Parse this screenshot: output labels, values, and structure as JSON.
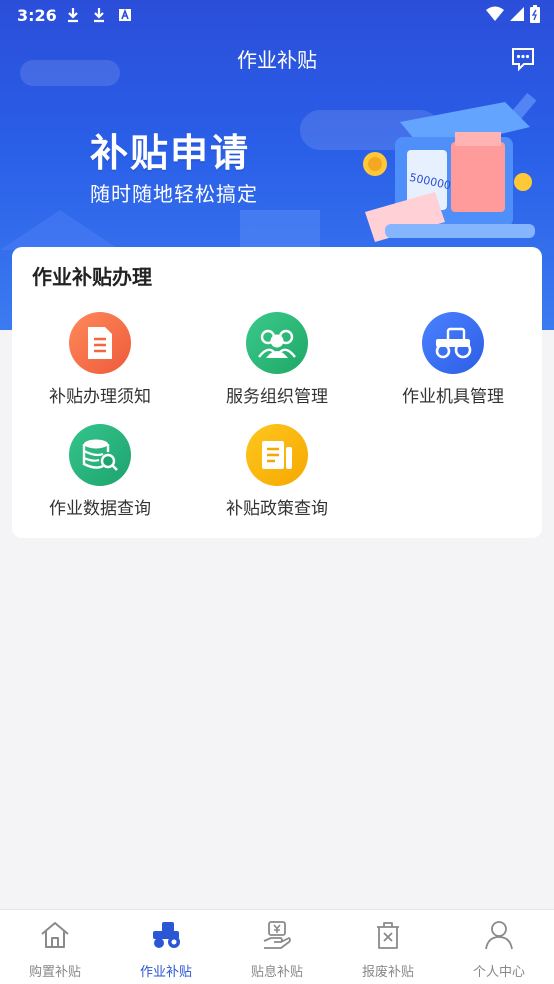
{
  "status_bar": {
    "time": "3:26"
  },
  "header": {
    "title": "作业补贴",
    "message_icon": "message-icon"
  },
  "banner": {
    "title": "补贴申请",
    "subtitle": "随时随地轻松搞定",
    "machine_label": "500000"
  },
  "section": {
    "title": "作业补贴办理",
    "items": [
      {
        "label": "补贴办理须知",
        "icon": "document-icon",
        "color": "#f0683f"
      },
      {
        "label": "服务组织管理",
        "icon": "group-icon",
        "color": "#2bb673"
      },
      {
        "label": "作业机具管理",
        "icon": "tractor-icon",
        "color": "#3a6ef0"
      },
      {
        "label": "作业数据查询",
        "icon": "database-search-icon",
        "color": "#24b27a"
      },
      {
        "label": "补贴政策查询",
        "icon": "policy-icon",
        "color": "#f7b500"
      }
    ]
  },
  "bottom_nav": {
    "items": [
      {
        "label": "购置补贴",
        "icon": "home-icon",
        "active": false
      },
      {
        "label": "作业补贴",
        "icon": "tractor-icon",
        "active": true
      },
      {
        "label": "贴息补贴",
        "icon": "yen-hand-icon",
        "active": false
      },
      {
        "label": "报废补贴",
        "icon": "scrap-box-icon",
        "active": false
      },
      {
        "label": "个人中心",
        "icon": "user-icon",
        "active": false
      }
    ]
  },
  "colors": {
    "accent": "#2b56d6",
    "banner_top": "#2b4ed9",
    "banner_bottom": "#3b7bf0",
    "inactive_nav": "#888888"
  }
}
